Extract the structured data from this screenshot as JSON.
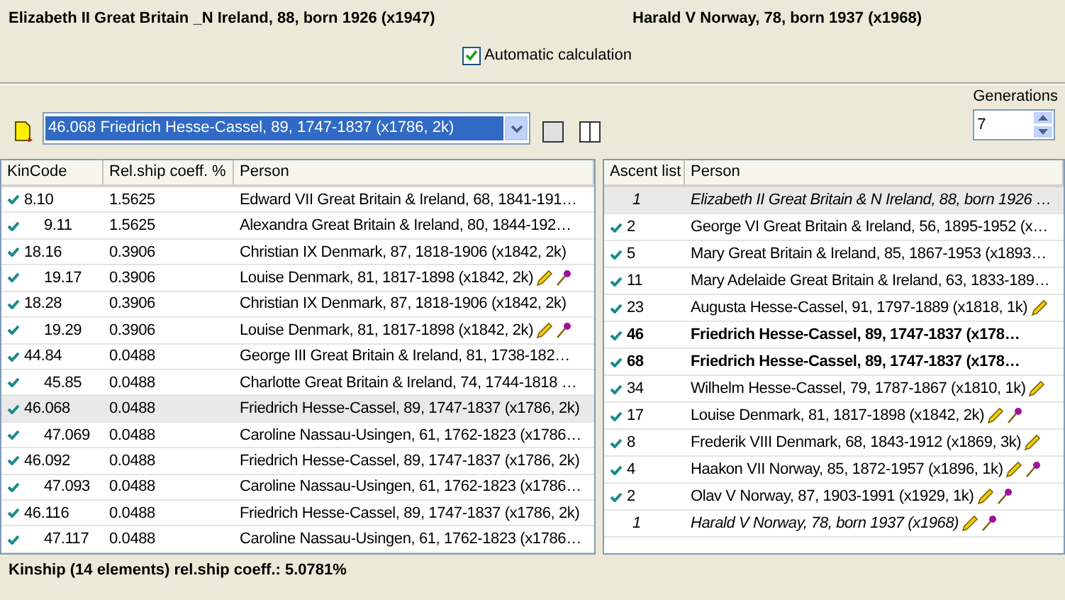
{
  "header": {
    "person_1": "Elizabeth II Great Britain _N Ireland, 88, born 1926 (x1947)",
    "person_2": "Harald V Norway, 78, born 1937 (x1968)"
  },
  "auto_calc": {
    "label": "Automatic calculation",
    "checked": true
  },
  "generations": {
    "label": "Generations",
    "value": "7"
  },
  "combo": {
    "value": "46.068 Friedrich Hesse-Cassel, 89, 1747-1837 (x1786, 2k)"
  },
  "kin_table": {
    "columns": [
      "KinCode",
      "Rel.ship coeff. %",
      "Person"
    ],
    "rows": [
      {
        "code": "8.10",
        "coeff": "1.5625",
        "person": "Edward VII Great Britain & Ireland, 68, 1841-191…",
        "checked": true,
        "selected": false,
        "pencil": false,
        "pin": false,
        "children": [
          {
            "code": "9.11",
            "coeff": "1.5625",
            "person": "Alexandra Great Britain & Ireland, 80, 1844-192…",
            "checked": true,
            "selected": false,
            "pencil": false,
            "pin": false
          }
        ]
      },
      {
        "code": "18.16",
        "coeff": "0.3906",
        "person": "Christian IX Denmark, 87, 1818-1906 (x1842, 2k)",
        "checked": true,
        "selected": false,
        "pencil": false,
        "pin": false,
        "children": [
          {
            "code": "19.17",
            "coeff": "0.3906",
            "person": "Louise Denmark, 81, 1817-1898 (x1842, 2k)",
            "checked": true,
            "selected": false,
            "pencil": true,
            "pin": true
          }
        ]
      },
      {
        "code": "18.28",
        "coeff": "0.3906",
        "person": "Christian IX Denmark, 87, 1818-1906 (x1842, 2k)",
        "checked": true,
        "selected": false,
        "pencil": false,
        "pin": false,
        "children": [
          {
            "code": "19.29",
            "coeff": "0.3906",
            "person": "Louise Denmark, 81, 1817-1898 (x1842, 2k)",
            "checked": true,
            "selected": false,
            "pencil": true,
            "pin": true
          }
        ]
      },
      {
        "code": "44.84",
        "coeff": "0.0488",
        "person": "George III Great Britain & Ireland, 81, 1738-182…",
        "checked": true,
        "selected": false,
        "pencil": false,
        "pin": false,
        "children": [
          {
            "code": "45.85",
            "coeff": "0.0488",
            "person": "Charlotte Great Britain & Ireland, 74, 1744-1818 …",
            "checked": true,
            "selected": false,
            "pencil": false,
            "pin": false
          }
        ]
      },
      {
        "code": "46.068",
        "coeff": "0.0488",
        "person": "Friedrich Hesse-Cassel, 89, 1747-1837 (x1786, 2k)",
        "checked": true,
        "selected": true,
        "pencil": false,
        "pin": false,
        "children": [
          {
            "code": "47.069",
            "coeff": "0.0488",
            "person": "Caroline Nassau-Usingen, 61, 1762-1823 (x1786…",
            "checked": true,
            "selected": false,
            "pencil": false,
            "pin": false
          }
        ]
      },
      {
        "code": "46.092",
        "coeff": "0.0488",
        "person": "Friedrich Hesse-Cassel, 89, 1747-1837 (x1786, 2k)",
        "checked": true,
        "selected": false,
        "pencil": false,
        "pin": false,
        "children": [
          {
            "code": "47.093",
            "coeff": "0.0488",
            "person": "Caroline Nassau-Usingen, 61, 1762-1823 (x1786…",
            "checked": true,
            "selected": false,
            "pencil": false,
            "pin": false
          }
        ]
      },
      {
        "code": "46.116",
        "coeff": "0.0488",
        "person": "Friedrich Hesse-Cassel, 89, 1747-1837 (x1786, 2k)",
        "checked": true,
        "selected": false,
        "pencil": false,
        "pin": false,
        "children": [
          {
            "code": "47.117",
            "coeff": "0.0488",
            "person": "Caroline Nassau-Usingen, 61, 1762-1823 (x1786…",
            "checked": true,
            "selected": false,
            "pencil": false,
            "pin": false
          }
        ]
      }
    ]
  },
  "ascent_table": {
    "columns": [
      "Ascent list",
      "Person"
    ],
    "rows": [
      {
        "number": "1",
        "person": "Elizabeth II Great Britain & N Ireland, 88, born 1926 …",
        "kind": "italic",
        "checked": false,
        "selected": true,
        "pencil": false,
        "pin": false
      },
      {
        "number": "2",
        "person": "George VI Great Britain & Ireland, 56, 1895-1952 (x…",
        "kind": "normal",
        "checked": true,
        "selected": false,
        "pencil": false,
        "pin": false
      },
      {
        "number": "5",
        "person": "Mary Great Britain & Ireland, 85, 1867-1953 (x1893…",
        "kind": "normal",
        "checked": true,
        "selected": false,
        "pencil": false,
        "pin": false
      },
      {
        "number": "11",
        "person": "Mary Adelaide Great Britain & Ireland, 63, 1833-189…",
        "kind": "normal",
        "checked": true,
        "selected": false,
        "pencil": false,
        "pin": false
      },
      {
        "number": "23",
        "person": "Augusta Hesse-Cassel, 91, 1797-1889 (x1818, 1k)",
        "kind": "normal",
        "checked": true,
        "selected": false,
        "pencil": true,
        "pin": false
      },
      {
        "number": "46",
        "person": "Friedrich Hesse-Cassel, 89, 1747-1837 (x178…",
        "kind": "bold",
        "checked": true,
        "selected": false,
        "pencil": false,
        "pin": false
      },
      {
        "number": "68",
        "person": "Friedrich Hesse-Cassel, 89, 1747-1837 (x178…",
        "kind": "bold",
        "checked": true,
        "selected": false,
        "pencil": false,
        "pin": false
      },
      {
        "number": "34",
        "person": "Wilhelm Hesse-Cassel, 79, 1787-1867 (x1810, 1k)",
        "kind": "normal",
        "checked": true,
        "selected": false,
        "pencil": true,
        "pin": false
      },
      {
        "number": "17",
        "person": "Louise Denmark, 81, 1817-1898 (x1842, 2k)",
        "kind": "normal",
        "checked": true,
        "selected": false,
        "pencil": true,
        "pin": true
      },
      {
        "number": "8",
        "person": "Frederik VIII Denmark, 68, 1843-1912 (x1869, 3k)",
        "kind": "normal",
        "checked": true,
        "selected": false,
        "pencil": true,
        "pin": false
      },
      {
        "number": "4",
        "person": "Haakon VII Norway, 85, 1872-1957 (x1896, 1k)",
        "kind": "normal",
        "checked": true,
        "selected": false,
        "pencil": true,
        "pin": true
      },
      {
        "number": "2",
        "person": "Olav V Norway, 87, 1903-1991 (x1929, 1k)",
        "kind": "normal",
        "checked": true,
        "selected": false,
        "pencil": true,
        "pin": true
      },
      {
        "number": "1",
        "person": "Harald V Norway, 78, born 1937 (x1968)",
        "kind": "italic",
        "checked": false,
        "selected": false,
        "pencil": true,
        "pin": true
      }
    ]
  },
  "status": "Kinship (14 elements) rel.ship coeff.: 5.0781%"
}
